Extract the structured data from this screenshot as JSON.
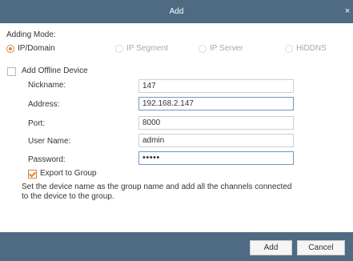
{
  "window": {
    "title": "Add",
    "close_glyph": "×"
  },
  "mode": {
    "label": "Adding Mode:",
    "options": [
      {
        "label": "IP/Domain",
        "selected": true,
        "enabled": true
      },
      {
        "label": "IP Segment",
        "selected": false,
        "enabled": false
      },
      {
        "label": "IP Server",
        "selected": false,
        "enabled": false
      },
      {
        "label": "HiDDNS",
        "selected": false,
        "enabled": false
      }
    ]
  },
  "offline": {
    "label": "Add Offline Device",
    "checked": false
  },
  "form": {
    "nickname": {
      "label": "Nickname:",
      "value": "147"
    },
    "address": {
      "label": "Address:",
      "value": "192.168.2.147"
    },
    "port": {
      "label": "Port:",
      "value": "8000"
    },
    "username": {
      "label": "User Name:",
      "value": "admin"
    },
    "password": {
      "label": "Password:",
      "value": "•••••"
    }
  },
  "export": {
    "label": "Export to Group",
    "checked": true,
    "description": "Set the device name as the group name and add all the channels connected to the device to the group."
  },
  "buttons": {
    "add": "Add",
    "cancel": "Cancel"
  },
  "colors": {
    "header_footer": "#4f6b84",
    "accent": "#e0862f",
    "focus_border": "#6e98c5"
  },
  "icons": {
    "close": "close-icon",
    "radio": "radio-icon",
    "checkbox": "checkbox-icon"
  }
}
